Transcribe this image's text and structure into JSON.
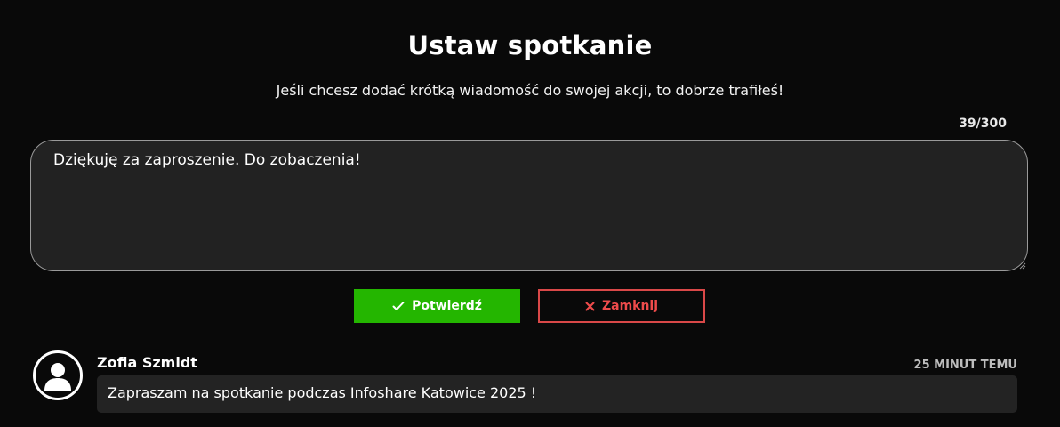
{
  "dialog": {
    "title": "Ustaw spotkanie",
    "subtitle": "Jeśli chcesz dodać krótką wiadomość do swojej akcji, to dobrze trafiłeś!",
    "counter": "39/300",
    "message_value": "Dziękuję za zaproszenie. Do zobaczenia!",
    "confirm_label": "Potwierdź",
    "close_label": "Zamknij",
    "confirm_icon": "check-icon",
    "close_icon": "x-icon"
  },
  "comment": {
    "author": "Zofia Szmidt",
    "time": "25 MINUT TEMU",
    "text": "Zapraszam na spotkanie podczas Infoshare Katowice 2025 !",
    "avatar_icon": "user-avatar-icon"
  },
  "colors": {
    "background": "#090909",
    "confirm": "#24b600",
    "close": "#d94848",
    "field": "#222222"
  }
}
